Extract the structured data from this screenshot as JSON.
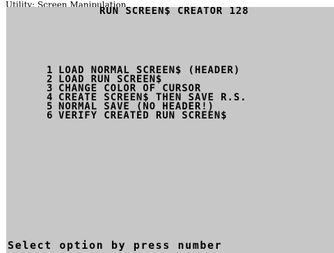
{
  "window": {
    "title": "Utility: Screen Manipulation"
  },
  "screen": {
    "background": "#c7c7c7",
    "ink": "#000000",
    "header": "RUN SCREEN$ CREATOR 128",
    "menu": [
      {
        "number": "1",
        "label": "LOAD NORMAL SCREEN$ (HEADER)"
      },
      {
        "number": "2",
        "label": "LOAD RUN SCREEN$"
      },
      {
        "number": "3",
        "label": "CHANGE COLOR OF CURSOR"
      },
      {
        "number": "4",
        "label": "CREATE SCREEN$ THEN SAVE R.S."
      },
      {
        "number": "5",
        "label": "NORMAL SAVE (NO HEADER!)"
      },
      {
        "number": "6",
        "label": "VERIFY CREATED RUN SCREEN$"
      }
    ],
    "prompt": "Select option by press number"
  }
}
